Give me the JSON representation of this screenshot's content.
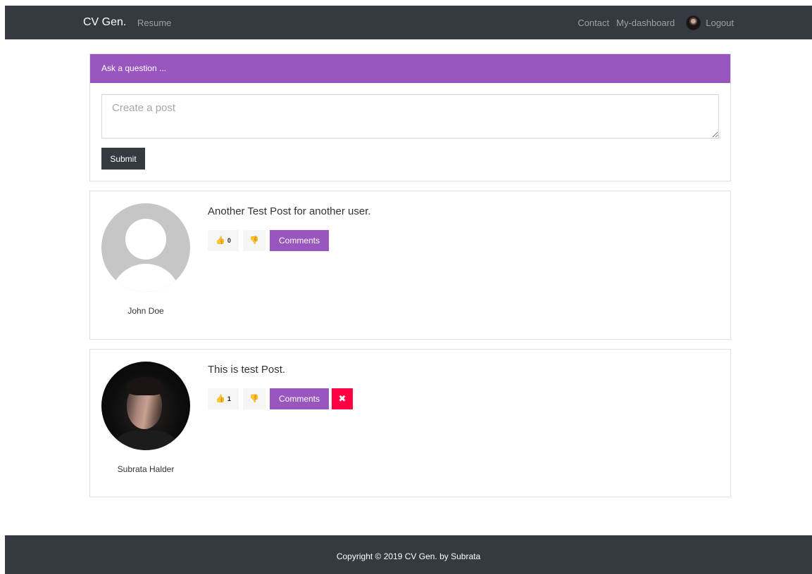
{
  "navbar": {
    "brand": "CV Gen.",
    "resume": "Resume",
    "contact": "Contact",
    "dashboard": "My-dashboard",
    "logout": "Logout"
  },
  "question": {
    "header": "Ask a question ...",
    "placeholder": "Create a post",
    "submit_label": "Submit"
  },
  "posts": [
    {
      "author": "John Doe",
      "text": "Another Test Post for another user.",
      "likes": "0",
      "comments_label": "Comments",
      "avatar": "default-user-avatar"
    },
    {
      "author": "Subrata Halder",
      "text": "This is test Post.",
      "likes": "1",
      "comments_label": "Comments",
      "delete_icon": "✖",
      "avatar": "user-photo-avatar"
    }
  ],
  "icons": {
    "thumb_up": "👍",
    "thumb_down": "👎"
  },
  "footer": {
    "copyright": "Copyright © 2019 CV Gen. by Subrata"
  },
  "colors": {
    "navbar": "#343a40",
    "accent_purple": "#9856be",
    "delete_red": "#ff0043"
  }
}
